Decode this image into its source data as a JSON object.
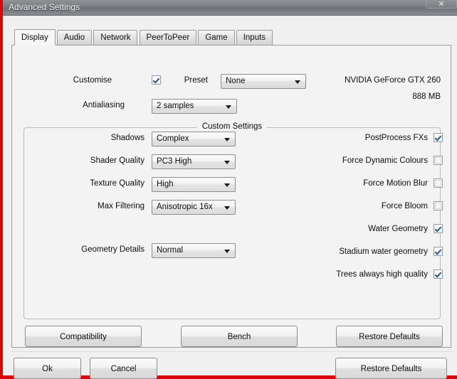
{
  "window": {
    "title": "Advanced Settings",
    "close_label": "✕",
    "accent_border": "#e20000",
    "titlebar_color": "#7d8085"
  },
  "tabs": [
    {
      "label": "Display",
      "active": true
    },
    {
      "label": "Audio",
      "active": false
    },
    {
      "label": "Network",
      "active": false
    },
    {
      "label": "PeerToPeer",
      "active": false
    },
    {
      "label": "Game",
      "active": false
    },
    {
      "label": "Inputs",
      "active": false
    }
  ],
  "display": {
    "customise": {
      "label": "Customise",
      "checked": true
    },
    "preset": {
      "label": "Preset",
      "value": "None"
    },
    "antialiasing": {
      "label": "Antialiasing",
      "value": "2 samples"
    },
    "gpu_name": "NVIDIA GeForce GTX 260",
    "gpu_memory": "888 MB",
    "custom_settings": {
      "title": "Custom Settings",
      "dropdowns": [
        {
          "label": "Shadows",
          "value": "Complex"
        },
        {
          "label": "Shader Quality",
          "value": "PC3 High"
        },
        {
          "label": "Texture Quality",
          "value": "High"
        },
        {
          "label": "Max Filtering",
          "value": "Anisotropic 16x"
        },
        {
          "label": "Geometry Details",
          "value": "Normal"
        }
      ],
      "checkboxes": [
        {
          "label": "PostProcess FXs",
          "checked": true
        },
        {
          "label": "Force Dynamic Colours",
          "checked": false
        },
        {
          "label": "Force Motion Blur",
          "checked": false
        },
        {
          "label": "Force Bloom",
          "checked": false
        },
        {
          "label": "Water Geometry",
          "checked": true
        },
        {
          "label": "Stadium water geometry",
          "checked": true
        },
        {
          "label": "Trees always high quality",
          "checked": true
        }
      ]
    },
    "panel_buttons": [
      {
        "label": "Compatibility"
      },
      {
        "label": "Bench"
      },
      {
        "label": "Restore Defaults"
      }
    ]
  },
  "footer": {
    "ok": "Ok",
    "cancel": "Cancel",
    "restore_defaults": "Restore Defaults"
  }
}
